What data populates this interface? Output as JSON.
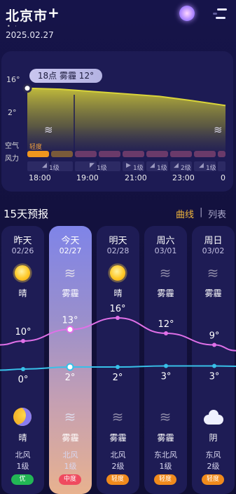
{
  "header": {
    "city": "北京市",
    "add_icon": "plus-icon",
    "page_indicator": "• ·",
    "date": "2025.02.27"
  },
  "hourly": {
    "tooltip": "18点 雾霾 12°",
    "y_labels": [
      "16°",
      "2°"
    ],
    "row_labels": [
      "空气",
      "风力"
    ],
    "air_label": "轻度",
    "wind_labels": [
      "1级",
      "1级",
      "1级",
      "1级",
      "2级",
      "1级"
    ],
    "times": [
      "18:00",
      "19:00",
      "21:00",
      "23:00",
      "0"
    ]
  },
  "chart_data": {
    "type": "area",
    "title": "",
    "xlabel": "",
    "ylabel": "",
    "x": [
      "18:00",
      "19:00",
      "20:00",
      "21:00",
      "22:00",
      "23:00",
      "0"
    ],
    "series": [
      {
        "values": [
          12,
          11.6,
          10.6,
          9.6,
          8.6,
          6.8,
          4.8
        ]
      }
    ],
    "ylim": [
      2,
      16
    ],
    "legend": "none",
    "grid": false
  },
  "forecast": {
    "title": "15天预报",
    "toggle_curve": "曲线",
    "toggle_sep": "|",
    "toggle_list": "列表",
    "days": [
      {
        "weekday": "昨天",
        "date": "02/26",
        "day_weather": "晴",
        "day_icon": "sun-icon",
        "high": "10°",
        "low": "0°",
        "night_weather": "晴",
        "night_icon": "moon-icon",
        "wind_dir": "北风",
        "wind_level": "1级",
        "aqi": "优",
        "aqi_color": "#22b655"
      },
      {
        "weekday": "今天",
        "date": "02/27",
        "day_weather": "雾霾",
        "day_icon": "haze-icon",
        "high": "13°",
        "low": "2°",
        "night_weather": "雾霾",
        "night_icon": "haze-icon",
        "wind_dir": "北风",
        "wind_level": "1级",
        "aqi": "中度",
        "aqi_color": "#ef4a5f"
      },
      {
        "weekday": "明天",
        "date": "02/28",
        "day_weather": "晴",
        "day_icon": "sun-icon",
        "high": "16°",
        "low": "2°",
        "night_weather": "雾霾",
        "night_icon": "haze-icon",
        "wind_dir": "北风",
        "wind_level": "2级",
        "aqi": "轻度",
        "aqi_color": "#f08a1c"
      },
      {
        "weekday": "周六",
        "date": "03/01",
        "day_weather": "雾霾",
        "day_icon": "haze-icon",
        "high": "12°",
        "low": "3°",
        "night_weather": "雾霾",
        "night_icon": "haze-icon",
        "wind_dir": "东北风",
        "wind_level": "1级",
        "aqi": "轻度",
        "aqi_color": "#f08a1c"
      },
      {
        "weekday": "周日",
        "date": "03/02",
        "day_weather": "雾霾",
        "day_icon": "haze-icon",
        "high": "9°",
        "low": "3°",
        "night_weather": "阴",
        "night_icon": "cloud-icon",
        "wind_dir": "东风",
        "wind_level": "2级",
        "aqi": "轻度",
        "aqi_color": "#f08a1c"
      }
    ],
    "high_color": "#e070e8",
    "low_color": "#38c0e8"
  }
}
